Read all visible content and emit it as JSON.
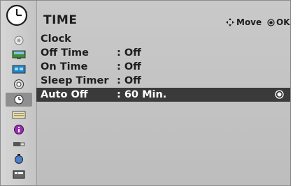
{
  "header": {
    "title": "TIME",
    "hint_move": "Move",
    "hint_ok": "OK"
  },
  "menu": {
    "rows": [
      {
        "label": "Clock",
        "value": ""
      },
      {
        "label": "Off Time",
        "value": ": Off"
      },
      {
        "label": "On Time",
        "value": ": Off"
      },
      {
        "label": "Sleep Timer",
        "value": ": Off"
      },
      {
        "label": "Auto Off",
        "value": ": 60 Min.",
        "selected": true
      }
    ]
  },
  "sidebar": {
    "items": [
      {
        "icon": "picture-settings-icon"
      },
      {
        "icon": "screen-icon"
      },
      {
        "icon": "pc-screen-icon"
      },
      {
        "icon": "audio-icon"
      },
      {
        "icon": "time-icon",
        "active": true
      },
      {
        "icon": "option-icon"
      },
      {
        "icon": "info-icon"
      },
      {
        "icon": "usb-icon"
      },
      {
        "icon": "timer-icon"
      },
      {
        "icon": "media-icon"
      }
    ]
  },
  "colors": {
    "background": "#c4c4c4",
    "selected_row": "#3a3a3a",
    "text": "#1f1f1f"
  }
}
